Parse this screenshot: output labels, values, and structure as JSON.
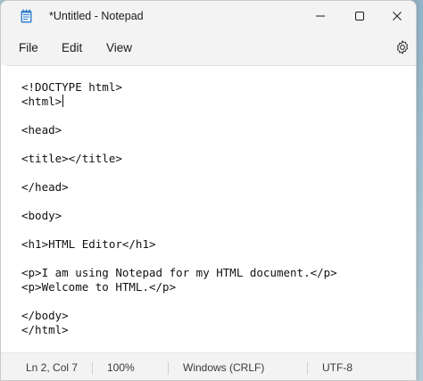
{
  "window": {
    "title": "*Untitled - Notepad"
  },
  "menu": {
    "file": "File",
    "edit": "Edit",
    "view": "View"
  },
  "icons": {
    "app": "notepad-icon",
    "minimize": "minimize-icon",
    "maximize": "maximize-icon",
    "close": "close-icon",
    "settings": "gear-icon"
  },
  "editor": {
    "lines": [
      "<!DOCTYPE html>",
      "<html>",
      "",
      "<head>",
      "",
      "<title></title>",
      "",
      "</head>",
      "",
      "<body>",
      "",
      "<h1>HTML Editor</h1>",
      "",
      "<p>I am using Notepad for my HTML document.</p>",
      "<p>Welcome to HTML.</p>",
      "",
      "</body>",
      "</html>"
    ]
  },
  "status": {
    "position": "Ln 2, Col 7",
    "zoom": "100%",
    "line_ending": "Windows (CRLF)",
    "encoding": "UTF-8"
  },
  "colors": {
    "chrome": "#f3f3f3",
    "editor_bg": "#ffffff",
    "text": "#1b1b1b"
  }
}
